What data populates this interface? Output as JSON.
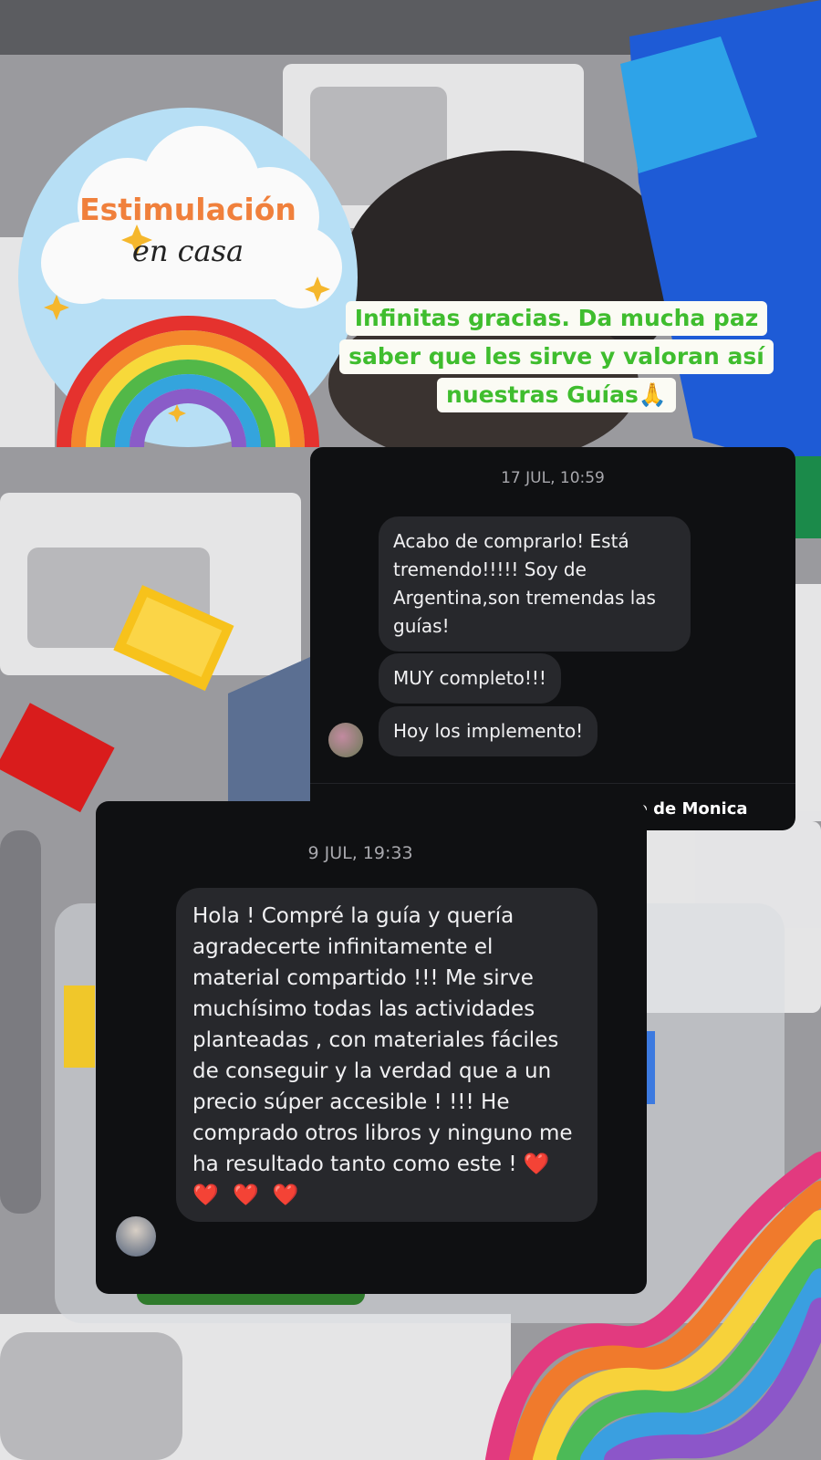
{
  "sticker": {
    "line1": "Estimulación",
    "line2": "en casa"
  },
  "caption": {
    "lines": [
      "Infinitas gracias. Da mucha paz",
      "saber que les sirve y valoran así",
      "nuestras Guías🙏"
    ]
  },
  "chat1": {
    "timestamp": "17 JUL, 10:59",
    "messages": [
      "Acabo de comprarlo! Está tremendo!!!!! Soy de Argentina,son tremendas las guías!",
      "MUY completo!!!",
      "Hoy los implemento!"
    ],
    "request_text": "¿Aceptar la solicitud de mensaje de Monica"
  },
  "chat2": {
    "timestamp": "9 JUL, 19:33",
    "message": "Hola ! Compré la guía y quería agradecerte infinitamente el material compartido !!! Me sirve muchísimo todas las actividades planteadas , con materiales fáciles de conseguir y la verdad que a un precio súper accesible ! !!! He comprado otros libros y ninguno me ha resultado tanto como este ! ",
    "hearts": "❤️ ❤️ ❤️ ❤️"
  },
  "colors": {
    "caption_green": "#3fbd2e",
    "chat_bg": "#0f1012",
    "bubble_bg": "#27282c",
    "sticker_orange": "#f0803c"
  }
}
